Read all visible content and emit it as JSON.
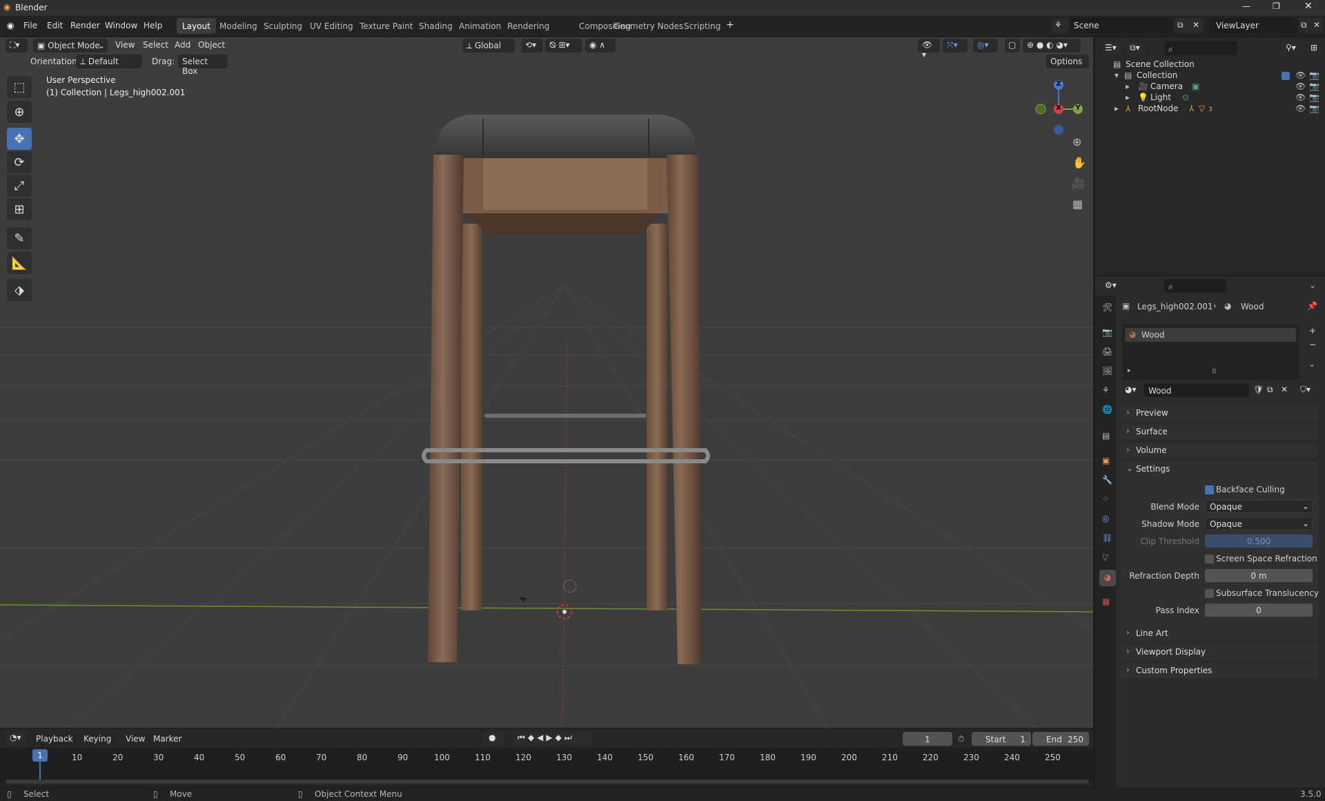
{
  "app": {
    "title": "Blender",
    "version": "3.5.0"
  },
  "menu": [
    "File",
    "Edit",
    "Render",
    "Window",
    "Help"
  ],
  "workspaces": [
    "Layout",
    "Modeling",
    "Sculpting",
    "UV Editing",
    "Texture Paint",
    "Shading",
    "Animation",
    "Rendering",
    "Compositing",
    "Geometry Nodes",
    "Scripting"
  ],
  "active_workspace": "Layout",
  "scene_name": "Scene",
  "view_layer": "ViewLayer",
  "viewport_header": {
    "mode": "Object Mode",
    "menus": [
      "View",
      "Select",
      "Add",
      "Object"
    ],
    "transform_orientation": "Global",
    "orientation_label": "Orientation:",
    "orientation_value": "Default",
    "drag_label": "Drag:",
    "drag_value": "Select Box",
    "options": "Options"
  },
  "viewport_info": {
    "line1": "User Perspective",
    "line2": "(1) Collection | Legs_high002.001"
  },
  "gizmo": {
    "x": "X",
    "y": "Y",
    "z": "Z"
  },
  "outliner": {
    "root": "Scene Collection",
    "items": [
      {
        "name": "Collection"
      },
      {
        "name": "Camera"
      },
      {
        "name": "Light"
      },
      {
        "name": "RootNode",
        "badge": "3"
      }
    ]
  },
  "properties": {
    "breadcrumb_object": "Legs_high002.001",
    "breadcrumb_material": "Wood",
    "slot_name": "Wood",
    "material_name": "Wood",
    "panels": {
      "preview": "Preview",
      "surface": "Surface",
      "volume": "Volume",
      "settings": "Settings",
      "line_art": "Line Art",
      "viewport_display": "Viewport Display",
      "custom_properties": "Custom Properties"
    },
    "settings": {
      "backface_culling_label": "Backface Culling",
      "backface_culling": true,
      "blend_mode_label": "Blend Mode",
      "blend_mode": "Opaque",
      "shadow_mode_label": "Shadow Mode",
      "shadow_mode": "Opaque",
      "clip_threshold_label": "Clip Threshold",
      "clip_threshold": "0.500",
      "ssr_label": "Screen Space Refraction",
      "ssr": false,
      "refraction_depth_label": "Refraction Depth",
      "refraction_depth": "0 m",
      "sss_label": "Subsurface Translucency",
      "sss": false,
      "pass_index_label": "Pass Index",
      "pass_index": "0"
    }
  },
  "timeline": {
    "menus": [
      "Playback",
      "Keying",
      "View",
      "Marker"
    ],
    "current_frame": "1",
    "start_label": "Start",
    "start": "1",
    "end_label": "End",
    "end": "250",
    "ticks": [
      "10",
      "20",
      "30",
      "40",
      "50",
      "60",
      "70",
      "80",
      "90",
      "100",
      "110",
      "120",
      "130",
      "140",
      "150",
      "160",
      "170",
      "180",
      "190",
      "200",
      "210",
      "220",
      "230",
      "240",
      "250"
    ]
  },
  "status": {
    "select": "Select",
    "move": "Move",
    "context": "Object Context Menu"
  }
}
